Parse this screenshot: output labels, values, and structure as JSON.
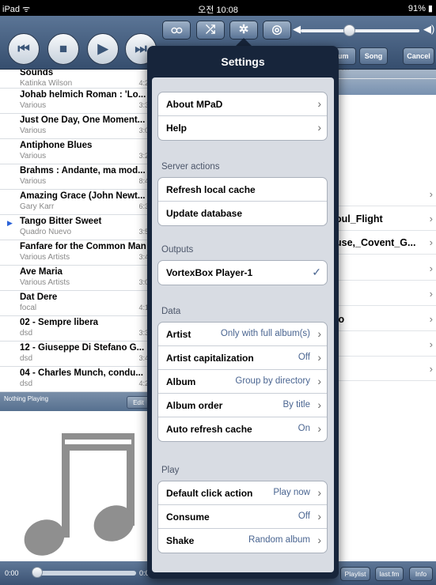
{
  "status_bar": {
    "left": "iPad ᯤ",
    "time": "오전 10:08",
    "battery": "91% ▮"
  },
  "toolbar": {
    "buttons": {
      "prev": "⏮",
      "stop": "■",
      "play": "▶",
      "next": "⏭"
    },
    "mode_buttons": {
      "repeat": "ထ",
      "shuffle": "⤮",
      "settings": "✲",
      "output": "◎"
    },
    "volume_low": "◀",
    "volume_high": "◀)",
    "volume_level": 0.38,
    "tabs": {
      "album": "bum",
      "song": "Song",
      "cancel": "Cancel"
    }
  },
  "songs": [
    {
      "title": "Sounds",
      "artist": "Katinka Wilson",
      "duration": "4:2"
    },
    {
      "title": "Johab helmich Roman : 'Lo...",
      "artist": "Various",
      "duration": "3:3"
    },
    {
      "title": "Just One Day, One Moment...",
      "artist": "Various",
      "duration": "3:0"
    },
    {
      "title": "Antiphone Blues",
      "artist": "Various",
      "duration": "3:2"
    },
    {
      "title": "Brahms : Andante, ma mod...",
      "artist": "Various",
      "duration": "8:4"
    },
    {
      "title": "Amazing Grace (John Newt...",
      "artist": "Gary Karr",
      "duration": "6:3"
    },
    {
      "title": "Tango Bitter Sweet",
      "artist": "Quadro Nuevo",
      "duration": "3:5",
      "playing": "▶"
    },
    {
      "title": "Fanfare for the Common Man",
      "artist": "Various Artists",
      "duration": "3:4"
    },
    {
      "title": "Ave Maria",
      "artist": "Various Artists",
      "duration": "3:0"
    },
    {
      "title": "Dat Dere",
      "artist": "focal",
      "duration": "4:1"
    },
    {
      "title": "02 - Sempre libera",
      "artist": "dsd",
      "duration": "3:3"
    },
    {
      "title": "12 - Giuseppe Di Stefano G...",
      "artist": "dsd",
      "duration": "3:4"
    },
    {
      "title": "04 - Charles Munch, condu...",
      "artist": "dsd",
      "duration": "4:2"
    }
  ],
  "now_playing": {
    "status": "Nothing Playing",
    "edit": "Edit"
  },
  "right_panel": [
    {
      "top": "- Allegro",
      "sub": "ZART",
      "chev": ""
    },
    {
      "top": "",
      "sub": "",
      "chev": "›"
    },
    {
      "top": "oul_Flight",
      "sub": "",
      "chev": "›"
    },
    {
      "top": "use,_Covent_G...",
      "sub": "",
      "chev": "›"
    },
    {
      "top": "",
      "sub": "",
      "chev": "›"
    },
    {
      "top": "",
      "sub": "",
      "chev": "›"
    },
    {
      "top": "io",
      "sub": "",
      "chev": "›"
    },
    {
      "top": "",
      "sub": "",
      "chev": "›"
    },
    {
      "top": "",
      "sub": "",
      "chev": "›"
    }
  ],
  "settings": {
    "title": "Settings",
    "group_general": [
      {
        "label": "About MPaD",
        "value": "",
        "accessory": "›"
      },
      {
        "label": "Help",
        "value": "",
        "accessory": "›"
      }
    ],
    "section_server": "Server actions",
    "group_server": [
      {
        "label": "Refresh local cache",
        "value": "",
        "accessory": ""
      },
      {
        "label": "Update database",
        "value": "",
        "accessory": ""
      }
    ],
    "section_outputs": "Outputs",
    "group_outputs": [
      {
        "label": "VortexBox Player-1",
        "value": "",
        "accessory": "✓"
      }
    ],
    "section_data": "Data",
    "group_data": [
      {
        "label": "Artist",
        "value": "Only with full album(s)",
        "accessory": "›"
      },
      {
        "label": "Artist capitalization",
        "value": "Off",
        "accessory": "›"
      },
      {
        "label": "Album",
        "value": "Group by directory",
        "accessory": "›"
      },
      {
        "label": "Album order",
        "value": "By title",
        "accessory": "›"
      },
      {
        "label": "Auto refresh cache",
        "value": "On",
        "accessory": "›"
      }
    ],
    "section_play": "Play",
    "group_play": [
      {
        "label": "Default click action",
        "value": "Play now",
        "accessory": "›"
      },
      {
        "label": "Consume",
        "value": "Off",
        "accessory": "›"
      },
      {
        "label": "Shake",
        "value": "Random album",
        "accessory": "›"
      }
    ]
  },
  "bottom_bar": {
    "time_elapsed": "0:00",
    "time_total": "0:0",
    "playlist": "Playlist",
    "lastfm": "last.fm",
    "info": "Info"
  }
}
